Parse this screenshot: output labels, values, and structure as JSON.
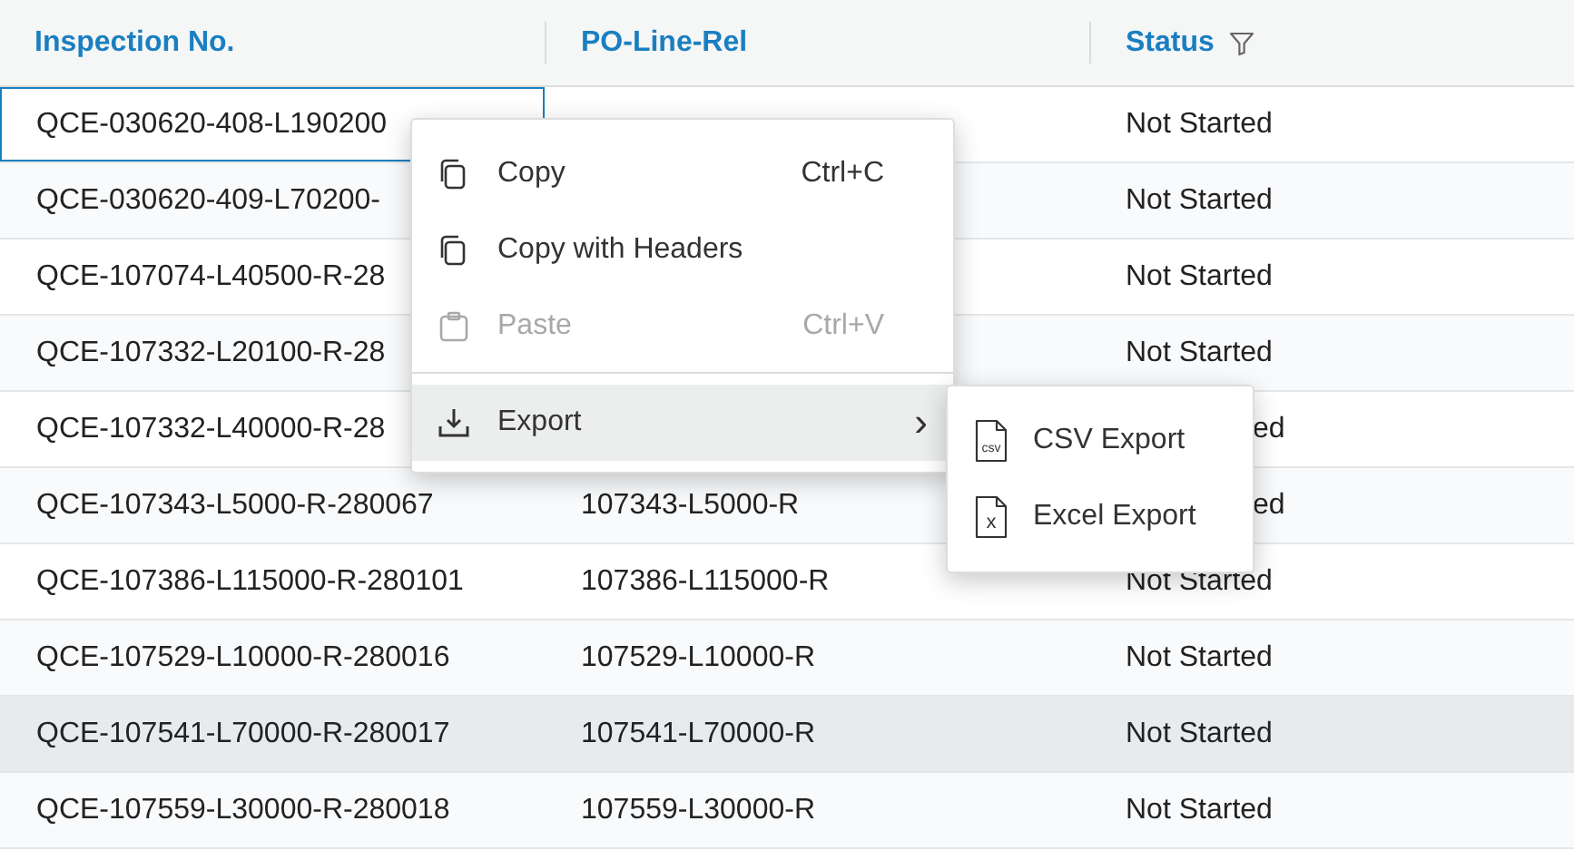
{
  "table": {
    "columns": [
      {
        "label": "Inspection No.",
        "filter": false
      },
      {
        "label": "PO-Line-Rel",
        "filter": false
      },
      {
        "label": "Status",
        "filter": true
      }
    ],
    "rows": [
      {
        "inspection_no": "QCE-030620-408-L190200",
        "status": "Not Started",
        "focused": true,
        "hovered": false,
        "status_partly_covered": false
      },
      {
        "inspection_no": "QCE-030620-409-L70200-",
        "status": "Not Started",
        "focused": false,
        "hovered": false,
        "status_partly_covered": false
      },
      {
        "inspection_no": "QCE-107074-L40500-R-28",
        "status": "Not Started",
        "focused": false,
        "hovered": false,
        "status_partly_covered": false
      },
      {
        "inspection_no": "QCE-107332-L20100-R-28",
        "status": "Not Started",
        "focused": false,
        "hovered": false,
        "status_partly_covered": false
      },
      {
        "inspection_no": "QCE-107332-L40000-R-28",
        "status": "ed",
        "focused": false,
        "hovered": false,
        "status_partly_covered": true
      },
      {
        "inspection_no": "QCE-107343-L5000-R-280067",
        "po_line_rel": "107343-L5000-R",
        "status": "ed",
        "focused": false,
        "hovered": false,
        "status_partly_covered": true
      },
      {
        "inspection_no": "QCE-107386-L115000-R-280101",
        "po_line_rel": "107386-L115000-R",
        "status": "Not Started",
        "focused": false,
        "hovered": false,
        "status_partly_covered": false
      },
      {
        "inspection_no": "QCE-107529-L10000-R-280016",
        "po_line_rel": "107529-L10000-R",
        "status": "Not Started",
        "focused": false,
        "hovered": false,
        "status_partly_covered": false
      },
      {
        "inspection_no": "QCE-107541-L70000-R-280017",
        "po_line_rel": "107541-L70000-R",
        "status": "Not Started",
        "focused": false,
        "hovered": true,
        "status_partly_covered": false
      },
      {
        "inspection_no": "QCE-107559-L30000-R-280018",
        "po_line_rel": "107559-L30000-R",
        "status": "Not Started",
        "focused": false,
        "hovered": false,
        "status_partly_covered": false
      }
    ]
  },
  "context_menu": {
    "items": [
      {
        "kind": "copy",
        "label": "Copy",
        "shortcut": "Ctrl+C",
        "disabled": false,
        "highlighted": false,
        "has_submenu": false
      },
      {
        "kind": "copy",
        "label": "Copy with Headers",
        "disabled": false,
        "highlighted": false,
        "has_submenu": false
      },
      {
        "kind": "paste",
        "label": "Paste",
        "shortcut": "Ctrl+V",
        "disabled": true,
        "highlighted": false,
        "has_submenu": false
      },
      {
        "kind": "separator"
      },
      {
        "kind": "export",
        "label": "Export",
        "disabled": false,
        "highlighted": true,
        "has_submenu": true,
        "arrow": "›"
      }
    ]
  },
  "submenu": {
    "items": [
      {
        "label": "CSV Export",
        "icon_text": "csv"
      },
      {
        "label": "Excel Export",
        "icon_text": "x"
      }
    ]
  }
}
